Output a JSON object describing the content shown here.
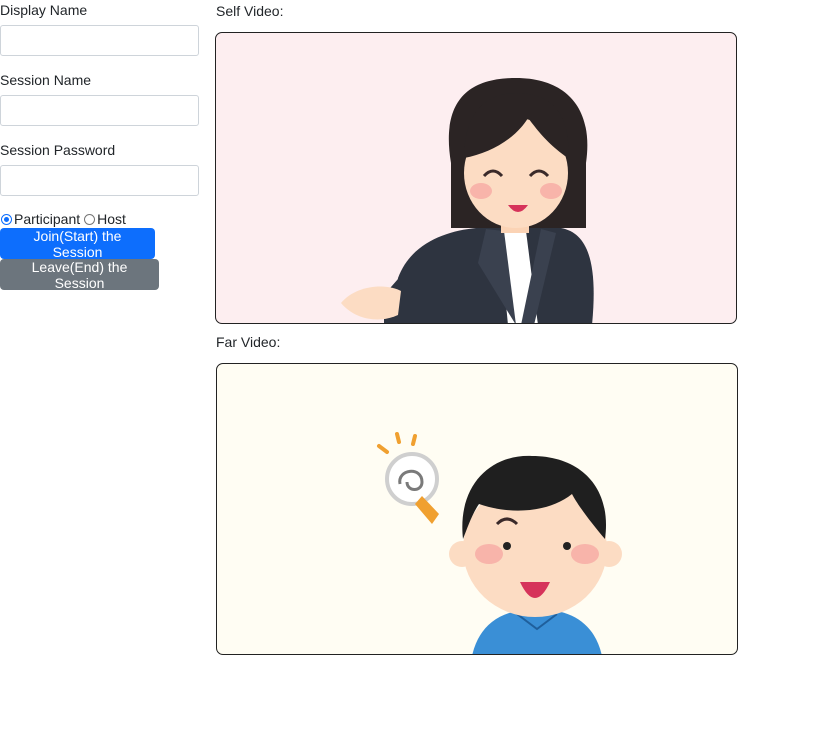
{
  "form": {
    "display_name_label": "Display Name",
    "display_name_value": "",
    "session_name_label": "Session Name",
    "session_name_value": "",
    "session_password_label": "Session Password",
    "session_password_value": "",
    "role_options": [
      {
        "label": "Participant",
        "selected": true
      },
      {
        "label": "Host",
        "selected": false
      }
    ],
    "join_button": "Join(Start) the Session",
    "leave_button": "Leave(End) the Session"
  },
  "videos": {
    "self_label": "Self Video:",
    "far_label": "Far Video:"
  },
  "colors": {
    "primary": "#0d6efd",
    "secondary": "#6c757d",
    "self_bg": "#fdeef0",
    "far_bg": "#fffdf3"
  }
}
